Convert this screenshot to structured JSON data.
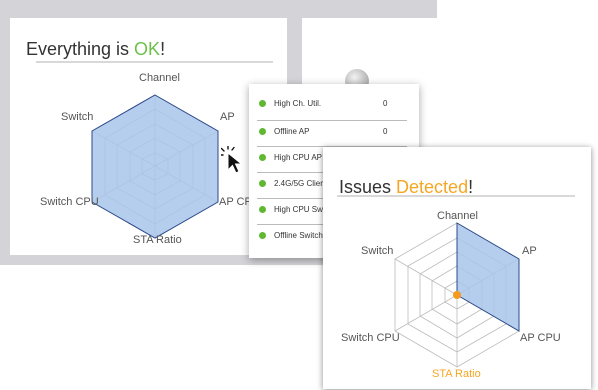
{
  "ok_panel": {
    "title_prefix": "Everything is ",
    "title_status": "OK",
    "title_suffix": "!",
    "labels": {
      "channel": "Channel",
      "ap": "AP",
      "ap_cpu": "AP CP",
      "sta_ratio": "STA Ratio",
      "switch_cpu": "Switch CPU",
      "switch": "Switch"
    }
  },
  "dropdown": {
    "items": [
      {
        "label": "High Ch. Util.",
        "count": "0"
      },
      {
        "label": "Offline AP",
        "count": "0"
      },
      {
        "label": "High CPU AP",
        "count": ""
      },
      {
        "label": "2.4G/5G Clien",
        "count": ""
      },
      {
        "label": "High CPU Sw",
        "count": ""
      },
      {
        "label": "Offline Switch",
        "count": ""
      }
    ],
    "status_color": "#5fb830"
  },
  "issues_panel": {
    "title_prefix": "Issues ",
    "title_status": "Detected",
    "title_suffix": "!",
    "labels": {
      "channel": "Channel",
      "ap": "AP",
      "ap_cpu": "AP CPU",
      "sta_ratio": "STA Ratio",
      "switch_cpu": "Switch CPU",
      "switch": "Switch"
    }
  },
  "colors": {
    "ok": "#6cc04a",
    "warning": "#f5a623",
    "radar_fill": "#a9c6ea",
    "radar_stroke": "#2c4a8c"
  }
}
